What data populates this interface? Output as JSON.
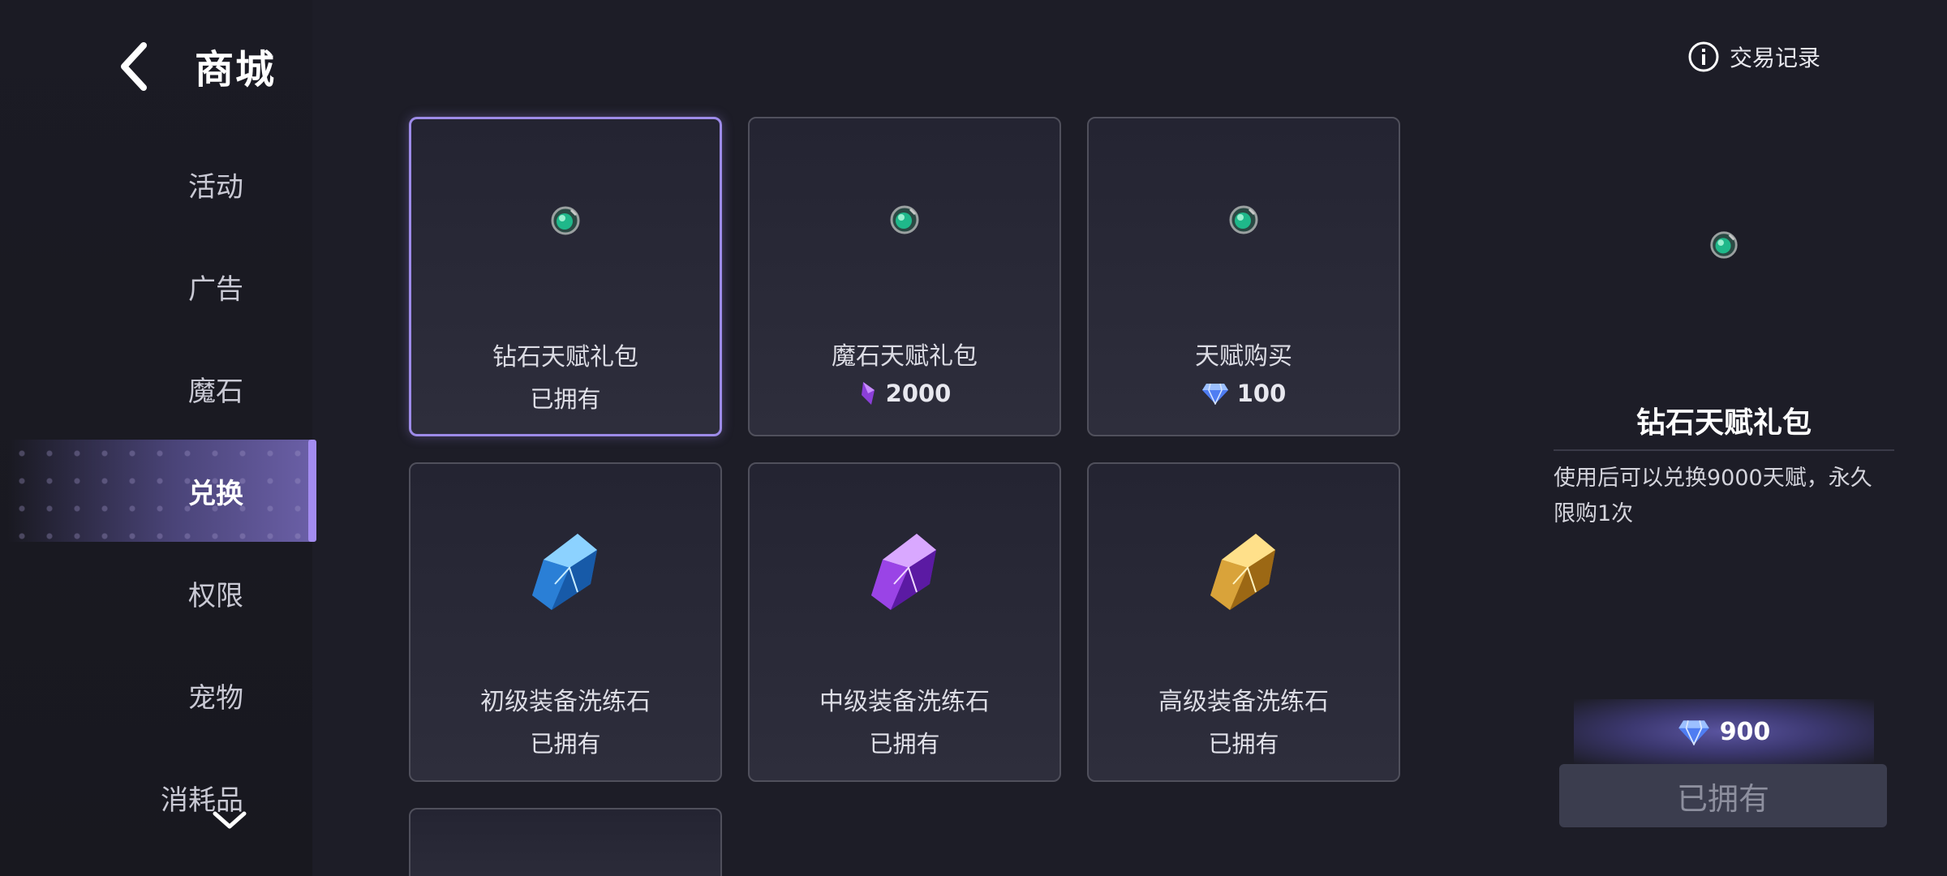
{
  "header": {
    "title": "商城",
    "transaction_label": "交易记录"
  },
  "sidebar": {
    "items": [
      {
        "label": "活动",
        "active": false
      },
      {
        "label": "广告",
        "active": false
      },
      {
        "label": "魔石",
        "active": false
      },
      {
        "label": "兑换",
        "active": true
      },
      {
        "label": "权限",
        "active": false
      },
      {
        "label": "宠物",
        "active": false
      },
      {
        "label": "消耗品",
        "active": false
      }
    ]
  },
  "products": [
    {
      "name": "钻石天赋礼包",
      "status": "已拥有",
      "icon": "green-talent-gem-icon",
      "selected": true
    },
    {
      "name": "魔石天赋礼包",
      "price": "2000",
      "currency": "magic-stone-icon",
      "icon": "green-talent-gem-icon"
    },
    {
      "name": "天赋购买",
      "price": "100",
      "currency": "diamond-icon",
      "icon": "green-talent-gem-icon"
    },
    {
      "name": "初级装备洗练石",
      "status": "已拥有",
      "icon": "blue-crystal-icon"
    },
    {
      "name": "中级装备洗练石",
      "status": "已拥有",
      "icon": "purple-crystal-icon"
    },
    {
      "name": "高级装备洗练石",
      "status": "已拥有",
      "icon": "gold-crystal-icon"
    }
  ],
  "detail": {
    "title": "钻石天赋礼包",
    "description": "使用后可以兑换9000天赋，永久限购1次",
    "price": "900",
    "button_label": "已拥有"
  },
  "colors": {
    "accent": "#9d8be8",
    "background": "#1d1d27",
    "card_border": "#50505c"
  }
}
